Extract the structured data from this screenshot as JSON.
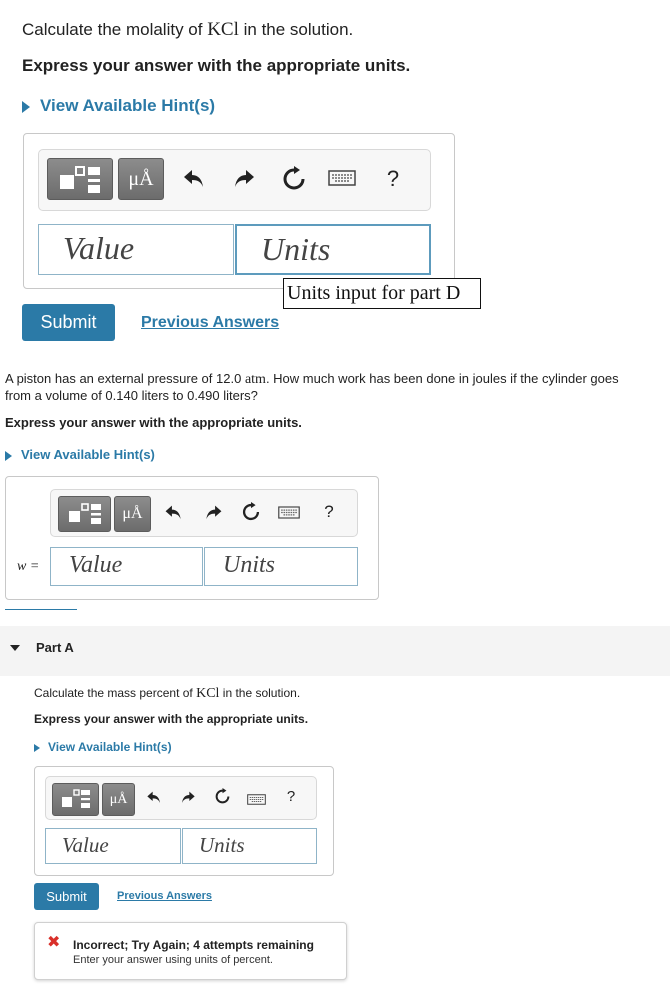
{
  "partD": {
    "prompt_before": "Calculate the molality of ",
    "formula": "KCl",
    "prompt_after": " in the solution.",
    "instruction": "Express your answer with the appropriate units.",
    "hint_label": "View Available Hint(s)",
    "toolbar": {
      "symbols_label": "μÅ",
      "help_label": "?"
    },
    "value_placeholder": "Value",
    "units_placeholder": "Units",
    "units_tooltip": "Units input for part D",
    "submit_label": "Submit",
    "previous_answers_label": "Previous Answers"
  },
  "piston": {
    "question_part1": "A piston has an external pressure of 12.0 ",
    "pressure_unit": "atm",
    "question_part2": ". How much work has been done in joules if the cylinder goes from a volume of 0.140 liters to 0.490 liters?",
    "instruction": "Express your answer with the appropriate units.",
    "hint_label": "View Available Hint(s)",
    "toolbar": {
      "symbols_label": "μÅ",
      "help_label": "?"
    },
    "variable_label": "w =",
    "value_placeholder": "Value",
    "units_placeholder": "Units"
  },
  "partA": {
    "header": "Part A",
    "prompt_before": "Calculate the mass percent of ",
    "formula": "KCl",
    "prompt_after": " in the solution.",
    "instruction": "Express your answer with the appropriate units.",
    "hint_label": "View Available Hint(s)",
    "toolbar": {
      "symbols_label": "μÅ",
      "help_label": "?"
    },
    "value_placeholder": "Value",
    "units_placeholder": "Units",
    "submit_label": "Submit",
    "previous_answers_label": "Previous Answers",
    "feedback_title": "Incorrect; Try Again; 4 attempts remaining",
    "feedback_detail": "Enter your answer using units of percent."
  },
  "colors": {
    "accent": "#2b7aa7",
    "error": "#d9302a"
  }
}
